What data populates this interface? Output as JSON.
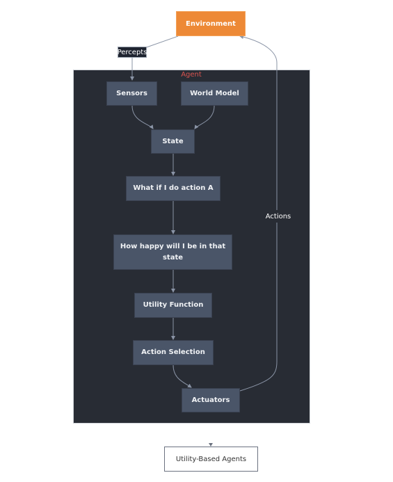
{
  "diagram": {
    "title": "Utility-Based Agents",
    "cluster_label": "Agent",
    "nodes": {
      "environment": "Environment",
      "sensors": "Sensors",
      "world_model": "World Model",
      "state": "State",
      "what_if": "What if I do action A",
      "how_happy": "How happy will I be in that state",
      "utility_function": "Utility Function",
      "action_selection": "Action Selection",
      "actuators": "Actuators"
    },
    "edge_labels": {
      "percepts": "Percepts",
      "actions": "Actions"
    },
    "edges": [
      {
        "from": "environment",
        "to": "sensors",
        "label": "Percepts"
      },
      {
        "from": "sensors",
        "to": "state"
      },
      {
        "from": "world_model",
        "to": "state"
      },
      {
        "from": "state",
        "to": "what_if"
      },
      {
        "from": "what_if",
        "to": "how_happy"
      },
      {
        "from": "how_happy",
        "to": "utility_function"
      },
      {
        "from": "utility_function",
        "to": "action_selection"
      },
      {
        "from": "action_selection",
        "to": "actuators"
      },
      {
        "from": "actuators",
        "to": "environment",
        "label": "Actions"
      }
    ],
    "colors": {
      "environment": "#ed8936",
      "node": "#4a5568",
      "cluster_bg": "#282c34",
      "cluster_label": "#d9534f",
      "edge": "#8a94a6"
    }
  }
}
